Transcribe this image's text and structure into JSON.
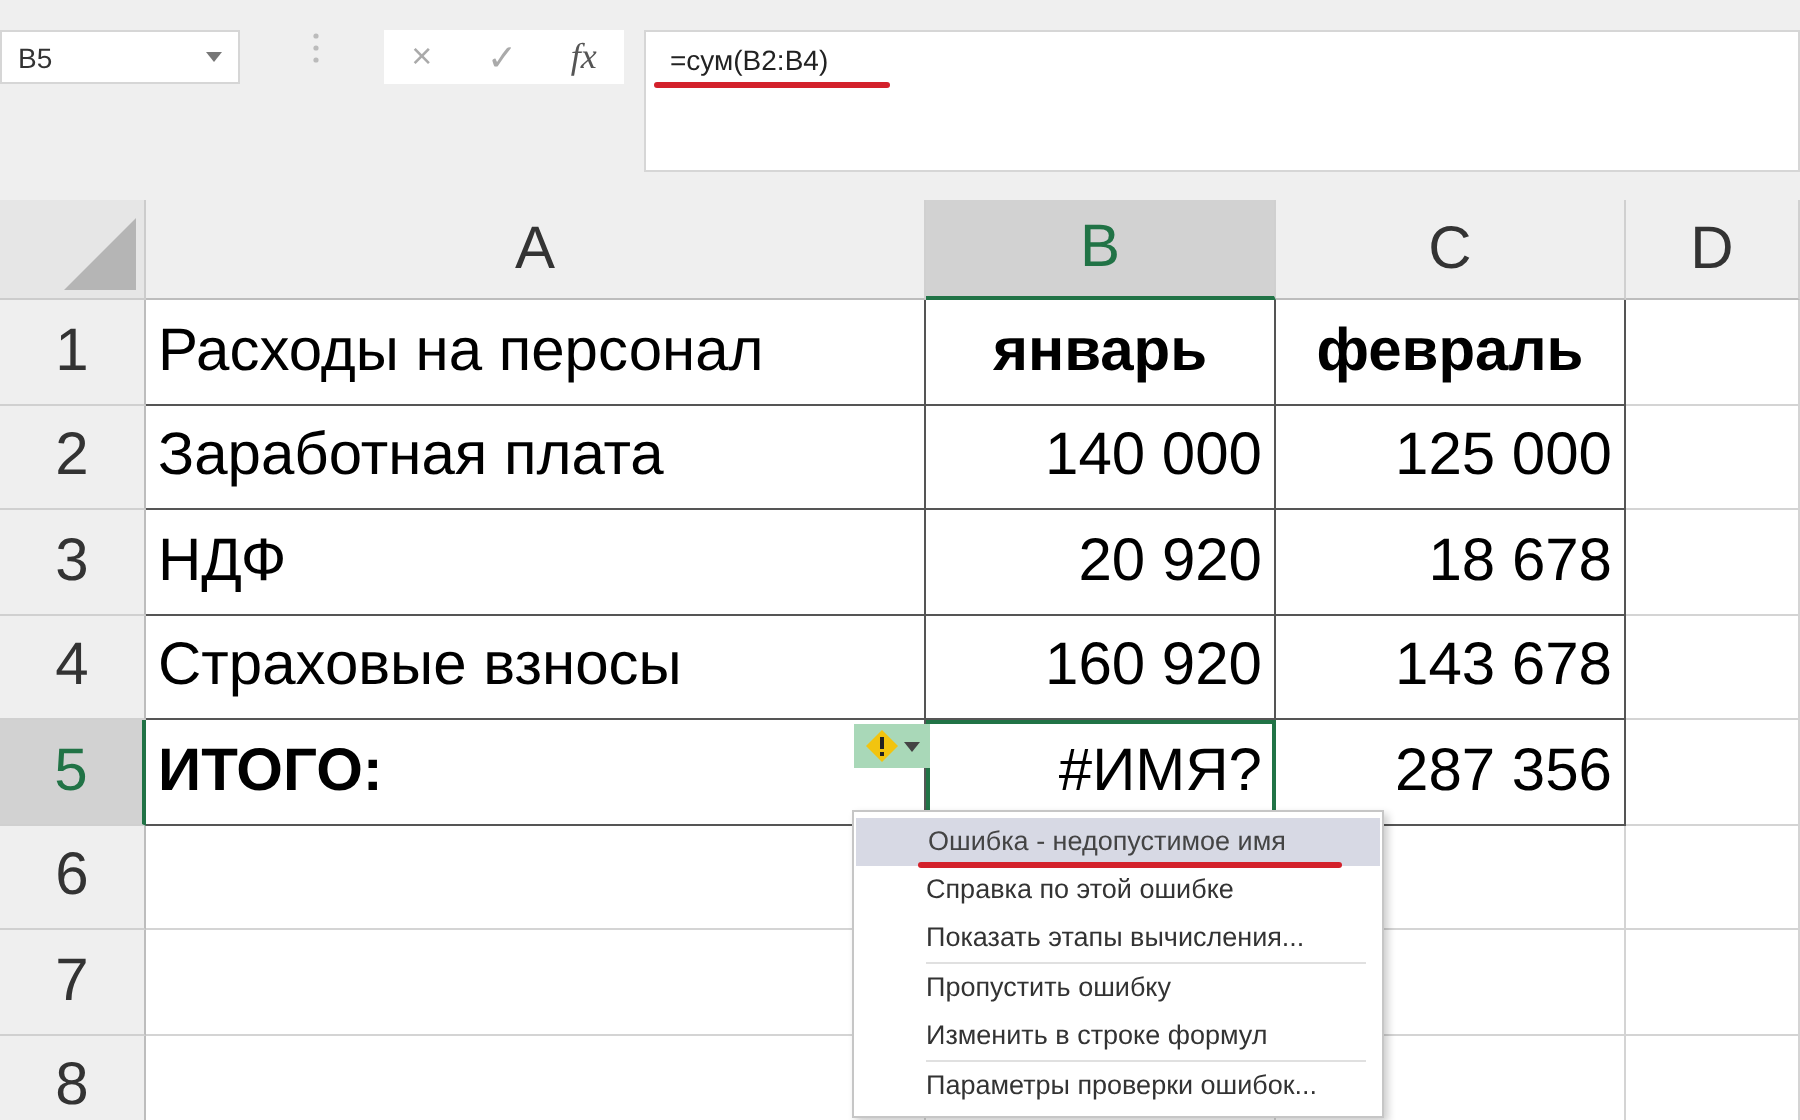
{
  "name_box": {
    "value": "B5"
  },
  "formula_bar": {
    "buttons": [
      "×",
      "✓",
      "fx"
    ],
    "value": "=сум(B2:B4)",
    "underlined": true
  },
  "columns": [
    {
      "label": "A",
      "selected": false
    },
    {
      "label": "B",
      "selected": true
    },
    {
      "label": "C",
      "selected": false
    },
    {
      "label": "D",
      "selected": false
    }
  ],
  "rows": [
    {
      "label": "1",
      "selected": false,
      "cells": [
        {
          "text": "Расходы на персонал",
          "kind": "text",
          "bold": false,
          "selected": false
        },
        {
          "text": "январь",
          "kind": "text",
          "bold": true,
          "selected": false
        },
        {
          "text": "февраль",
          "kind": "text",
          "bold": true,
          "selected": false
        }
      ]
    },
    {
      "label": "2",
      "selected": false,
      "cells": [
        {
          "text": "Заработная плата",
          "kind": "text",
          "bold": false,
          "selected": false
        },
        {
          "text": "140 000",
          "kind": "number",
          "bold": false,
          "selected": false
        },
        {
          "text": "125 000",
          "kind": "number",
          "bold": false,
          "selected": false
        }
      ]
    },
    {
      "label": "3",
      "selected": false,
      "cells": [
        {
          "text": "НДФ",
          "kind": "text",
          "bold": false,
          "selected": false
        },
        {
          "text": "20 920",
          "kind": "number",
          "bold": false,
          "selected": false
        },
        {
          "text": "18 678",
          "kind": "number",
          "bold": false,
          "selected": false
        }
      ]
    },
    {
      "label": "4",
      "selected": false,
      "cells": [
        {
          "text": "Страховые взносы",
          "kind": "text",
          "bold": false,
          "selected": false
        },
        {
          "text": "160 920",
          "kind": "number",
          "bold": false,
          "selected": false
        },
        {
          "text": "143 678",
          "kind": "number",
          "bold": false,
          "selected": false
        }
      ]
    },
    {
      "label": "5",
      "selected": true,
      "cells": [
        {
          "text": "ИТОГО:",
          "kind": "text",
          "bold": true,
          "selected": false
        },
        {
          "text": "#ИМЯ?",
          "kind": "number",
          "bold": false,
          "selected": true
        },
        {
          "text": "287 356",
          "kind": "number",
          "bold": false,
          "selected": false
        }
      ]
    },
    {
      "label": "6",
      "selected": false,
      "cells": []
    },
    {
      "label": "7",
      "selected": false,
      "cells": []
    },
    {
      "label": "8",
      "selected": false,
      "cells": []
    }
  ],
  "error_menu": {
    "items": [
      {
        "label": "Ошибка - недопустимое имя",
        "kind": "title",
        "selected": true,
        "underlined": true,
        "separator_before": false
      },
      {
        "label": "Справка по этой ошибке",
        "kind": "action",
        "selected": false,
        "underlined": false,
        "separator_before": false
      },
      {
        "label": "Показать этапы вычисления...",
        "kind": "action",
        "selected": false,
        "underlined": false,
        "separator_before": false
      },
      {
        "label": "Пропустить ошибку",
        "kind": "action",
        "selected": false,
        "underlined": false,
        "separator_before": true
      },
      {
        "label": "Изменить в строке формул",
        "kind": "action",
        "selected": false,
        "underlined": false,
        "separator_before": false
      },
      {
        "label": "Параметры проверки ошибок...",
        "kind": "action",
        "selected": false,
        "underlined": false,
        "separator_before": true
      }
    ]
  }
}
